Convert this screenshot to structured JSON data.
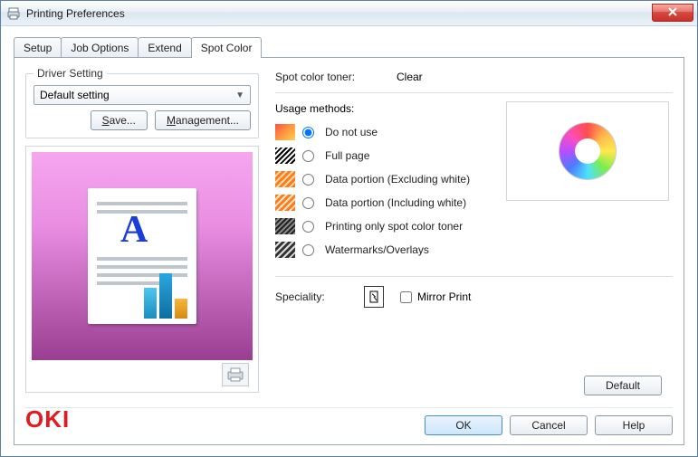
{
  "window": {
    "title": "Printing Preferences"
  },
  "tabs": [
    {
      "label": "Setup"
    },
    {
      "label": "Job Options"
    },
    {
      "label": "Extend"
    },
    {
      "label": "Spot Color"
    }
  ],
  "active_tab_index": 3,
  "driver_setting": {
    "legend": "Driver Setting",
    "selected": "Default setting",
    "save_btn": "Save...",
    "management_btn": "Management..."
  },
  "logo_text": "OKI",
  "spot_color": {
    "label": "Spot color toner:",
    "value": "Clear"
  },
  "usage": {
    "heading": "Usage methods:",
    "options": [
      {
        "label": "Do not use"
      },
      {
        "label": "Full page"
      },
      {
        "label": "Data portion (Excluding white)"
      },
      {
        "label": "Data portion (Including white)"
      },
      {
        "label": "Printing only spot color toner"
      },
      {
        "label": "Watermarks/Overlays"
      }
    ],
    "selected_index": 0
  },
  "speciality": {
    "label": "Speciality:",
    "mirror_label": "Mirror Print",
    "mirror_checked": false
  },
  "buttons": {
    "default": "Default",
    "ok": "OK",
    "cancel": "Cancel",
    "help": "Help"
  }
}
